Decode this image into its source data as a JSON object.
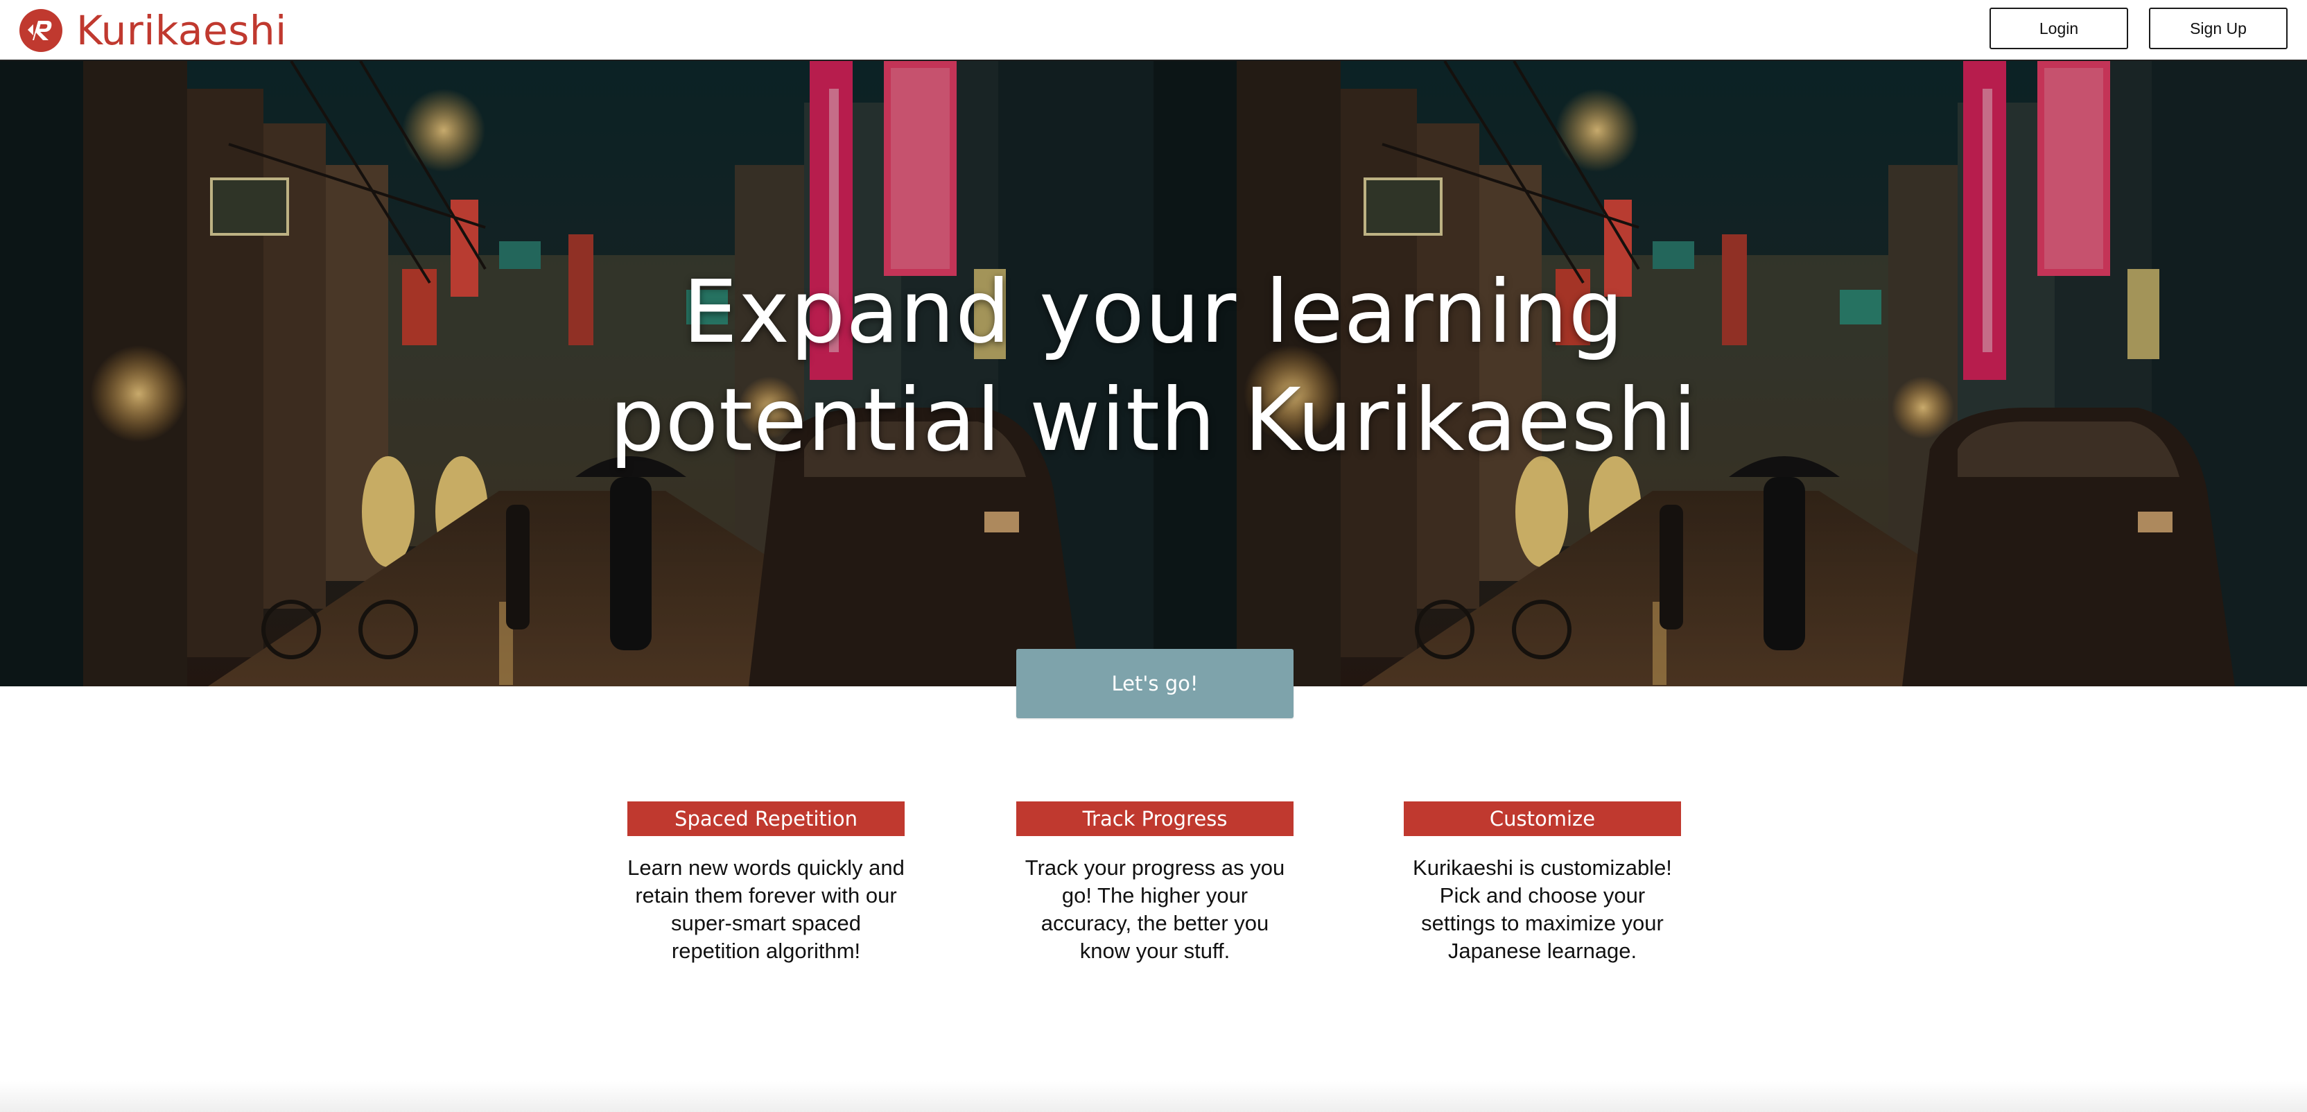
{
  "navbar": {
    "brand_name": "Kurikaeshi",
    "login_label": "Login",
    "signup_label": "Sign Up"
  },
  "hero": {
    "title": "Expand your learning\npotential with Kurikaeshi",
    "background_image": "night-city-street-photo"
  },
  "cta": {
    "label": "Let's go!"
  },
  "features": [
    {
      "title": "Spaced Repetition",
      "text": "Learn new words quickly and retain them forever with our super-smart spaced repetition algorithm!"
    },
    {
      "title": "Track Progress",
      "text": "Track your progress as you go! The higher your accuracy, the better you know your stuff."
    },
    {
      "title": "Customize",
      "text": "Kurikaeshi is customizable! Pick and choose your settings to maximize your Japanese learnage."
    }
  ],
  "colors": {
    "brand_red": "#c0392f",
    "cta_blue_gray": "#7ea3ab",
    "text_dark": "#111111"
  }
}
